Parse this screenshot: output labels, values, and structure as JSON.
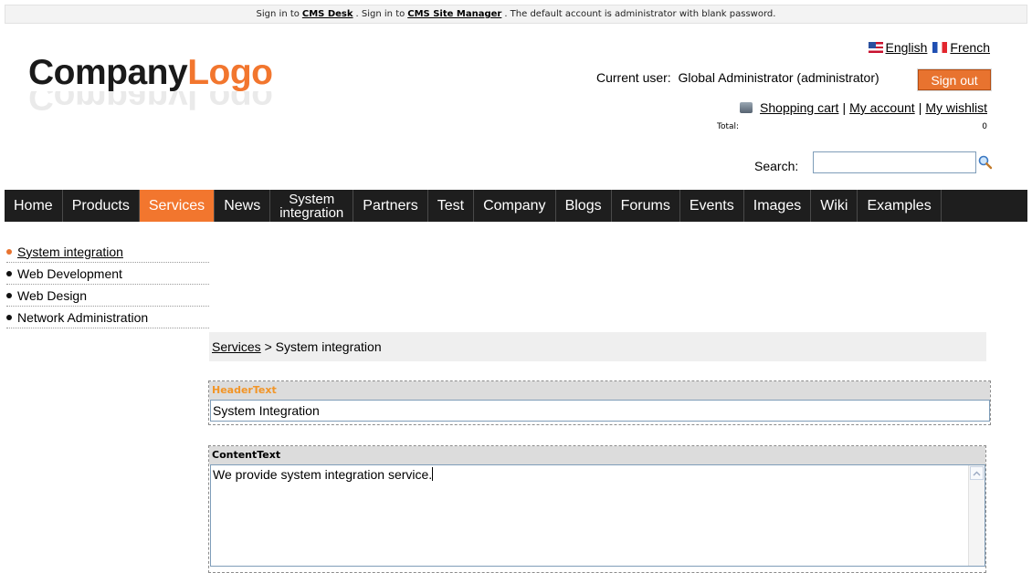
{
  "topbar": {
    "prefix": "Sign in to",
    "cms_desk": "CMS Desk",
    "mid": ". Sign in to",
    "site_manager": "CMS Site Manager",
    "suffix": ". The default account is administrator with blank password."
  },
  "logo": {
    "part1": "Company",
    "part2": "Logo"
  },
  "languages": [
    {
      "label": "English",
      "icon": "us-flag-icon"
    },
    {
      "label": "French",
      "icon": "france-flag-icon"
    }
  ],
  "user": {
    "label": "Current user:",
    "name": "Global Administrator (administrator)",
    "signout": "Sign out"
  },
  "cart": {
    "shopping_cart": "Shopping cart",
    "sep": "|",
    "my_account": "My account",
    "my_wishlist": "My wishlist",
    "total_label": "Total:",
    "total_value": "0"
  },
  "search": {
    "label": "Search:",
    "value": ""
  },
  "nav": {
    "items": [
      "Home",
      "Products",
      "Services",
      "News",
      "System integration",
      "Partners",
      "Test",
      "Company",
      "Blogs",
      "Forums",
      "Events",
      "Images",
      "Wiki",
      "Examples"
    ],
    "system_line1": "System",
    "system_line2": "integration",
    "active": "Services"
  },
  "subnav": {
    "items": [
      "System integration",
      "Web Development",
      "Web Design",
      "Network Administration"
    ]
  },
  "breadcrumb": {
    "parent": "Services",
    "sep": ">",
    "current": "System integration"
  },
  "editor": {
    "header_label": "HeaderText",
    "header_value": "System Integration",
    "content_label": "ContentText",
    "content_value": "We provide system integration service."
  },
  "colors": {
    "accent": "#f2762e",
    "nav_bg": "#1e1e1e"
  }
}
